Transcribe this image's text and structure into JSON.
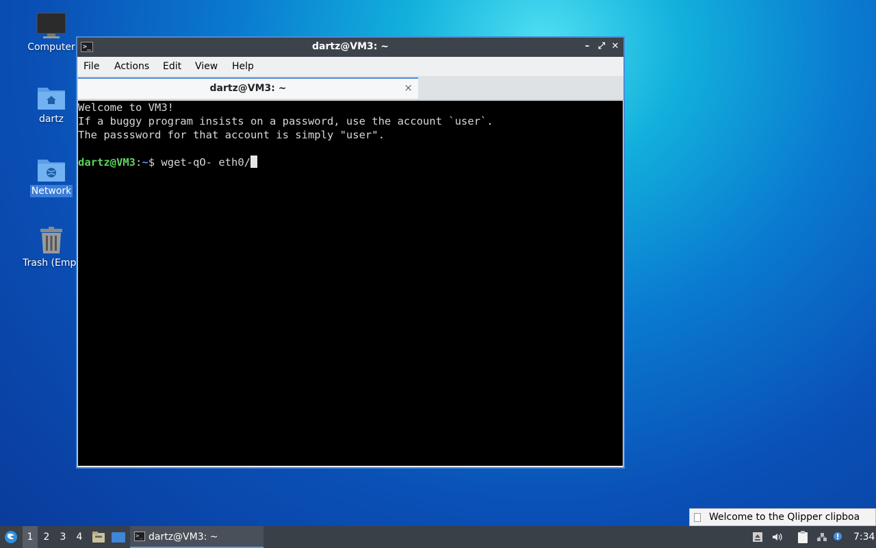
{
  "desktop": {
    "icons": [
      {
        "label": "Computer"
      },
      {
        "label": "dartz"
      },
      {
        "label": "Network"
      },
      {
        "label": "Trash (Empt"
      }
    ]
  },
  "window": {
    "title": "dartz@VM3: ~",
    "menu": [
      "File",
      "Actions",
      "Edit",
      "View",
      "Help"
    ],
    "tab_label": "dartz@VM3: ~",
    "tab_close": "×",
    "buttons": {
      "minimize": "–",
      "maximize": "⤢",
      "close": "✕"
    }
  },
  "terminal": {
    "lines": [
      "Welcome to VM3!",
      "If a buggy program insists on a password, use the account `user`.",
      "The passsword for that account is simply \"user\"."
    ],
    "prompt_user": "dartz@VM3",
    "prompt_sep": ":",
    "prompt_path": "~",
    "prompt_symbol": "$ ",
    "command": "wget-qO- eth0/"
  },
  "notification": {
    "text": "Welcome to the Qlipper clipboa"
  },
  "taskbar": {
    "workspaces": [
      "1",
      "2",
      "3",
      "4"
    ],
    "task_label": "dartz@VM3: ~",
    "clock": "7:34"
  }
}
